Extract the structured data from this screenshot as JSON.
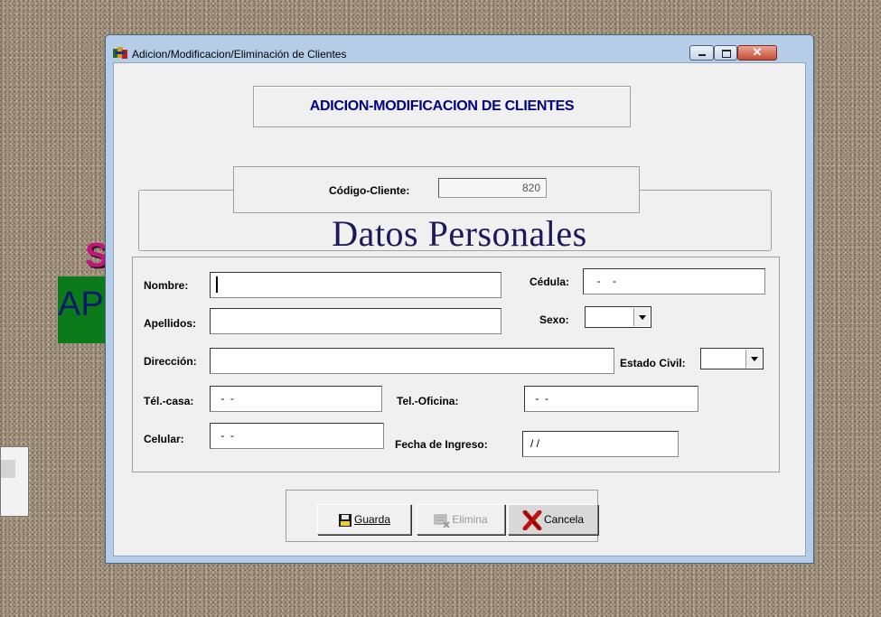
{
  "window": {
    "title": "Adicion/Modificacion/Eliminación de Clientes"
  },
  "background": {
    "fragment_s": "S",
    "fragment_ap": "AP"
  },
  "form": {
    "heading": "ADICION-MODIFICACION DE CLIENTES",
    "code_label": "Código-Cliente:",
    "code_value": "820",
    "section_title": "Datos Personales",
    "fields": {
      "nombre": {
        "label": "Nombre:",
        "value": ""
      },
      "cedula": {
        "label": "Cédula:",
        "value": "  -    -"
      },
      "apellidos": {
        "label": "Apellidos:",
        "value": ""
      },
      "sexo": {
        "label": "Sexo:",
        "value": ""
      },
      "direccion": {
        "label": "Dirección:",
        "value": ""
      },
      "estado_civil": {
        "label": "Estado Civil:",
        "value": ""
      },
      "tel_casa": {
        "label": "Tél.-casa:",
        "value": " -  -"
      },
      "tel_oficina": {
        "label": "Tel.-Oficina:",
        "value": " -  -"
      },
      "celular": {
        "label": "Celular:",
        "value": " -  -"
      },
      "fecha_ingreso": {
        "label": "Fecha de Ingreso:",
        "value": "/ /"
      }
    }
  },
  "buttons": {
    "guarda": "Guarda",
    "elimina": "Elimina",
    "cancela": "Cancela"
  },
  "icons": {
    "app": "app-icon",
    "guarda": "floppy-disk-icon",
    "elimina": "delete-record-icon",
    "cancela": "red-x-icon"
  },
  "colors": {
    "heading_text": "#000080",
    "section_title": "#1a1a5a",
    "window_frame": "#b6cde8",
    "close_button": "#c44d35"
  }
}
